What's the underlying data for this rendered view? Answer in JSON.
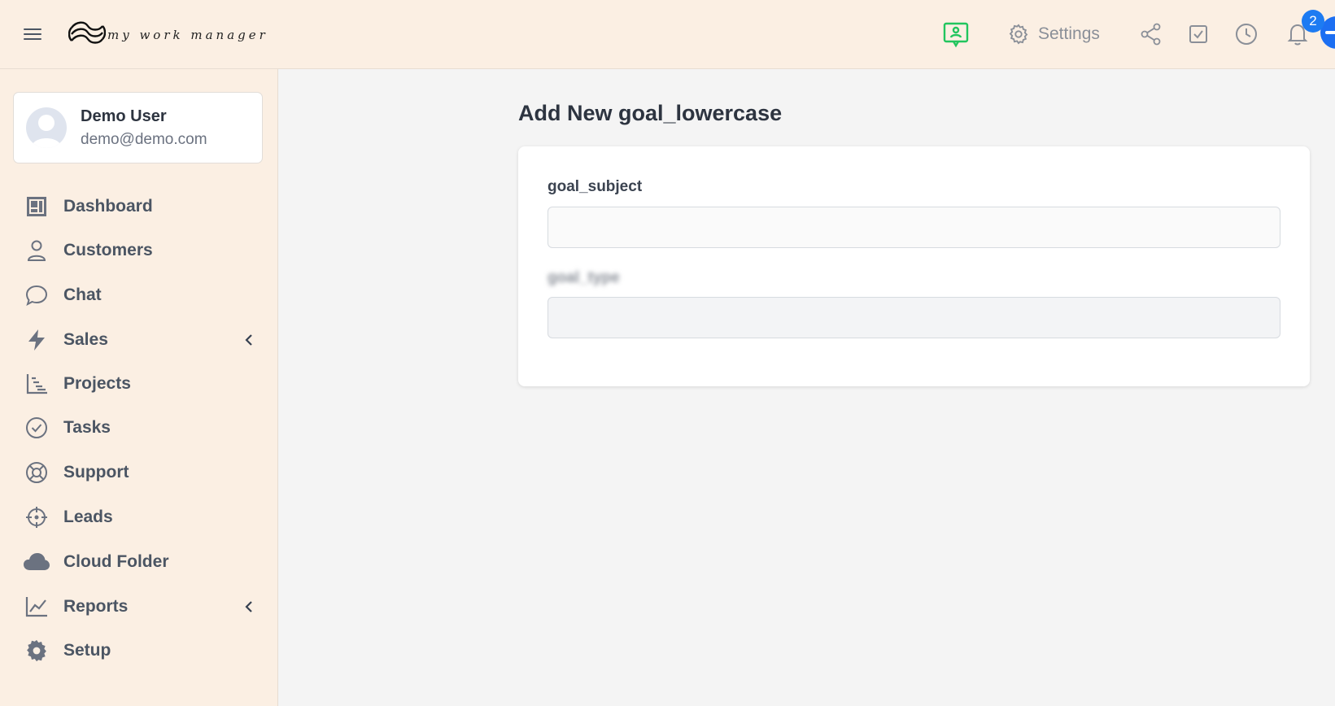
{
  "header": {
    "logo_text": "my work manager",
    "settings_label": "Settings",
    "notification_count": "2"
  },
  "sidebar": {
    "user": {
      "name": "Demo User",
      "email": "demo@demo.com"
    },
    "items": [
      {
        "label": "Dashboard",
        "icon": "dashboard-icon"
      },
      {
        "label": "Customers",
        "icon": "user-icon"
      },
      {
        "label": "Chat",
        "icon": "chat-bubble-icon"
      },
      {
        "label": "Sales",
        "icon": "lightning-icon",
        "expandable": true
      },
      {
        "label": "Projects",
        "icon": "gantt-chart-icon"
      },
      {
        "label": "Tasks",
        "icon": "check-circle-icon"
      },
      {
        "label": "Support",
        "icon": "lifebuoy-icon"
      },
      {
        "label": "Leads",
        "icon": "crosshair-icon"
      },
      {
        "label": "Cloud Folder",
        "icon": "cloud-icon"
      },
      {
        "label": "Reports",
        "icon": "line-chart-icon",
        "expandable": true
      },
      {
        "label": "Setup",
        "icon": "gear-icon"
      }
    ]
  },
  "main": {
    "title": "Add New goal_lowercase",
    "form": {
      "fields": [
        {
          "label": "goal_subject",
          "value": ""
        },
        {
          "label": "goal_type",
          "value": ""
        }
      ]
    }
  },
  "colors": {
    "header_bg": "#fbefe3",
    "sidebar_bg": "#fbefe3",
    "content_bg": "#f4f4f4",
    "accent_green": "#22c55e",
    "badge_blue": "#1d7bf2"
  }
}
